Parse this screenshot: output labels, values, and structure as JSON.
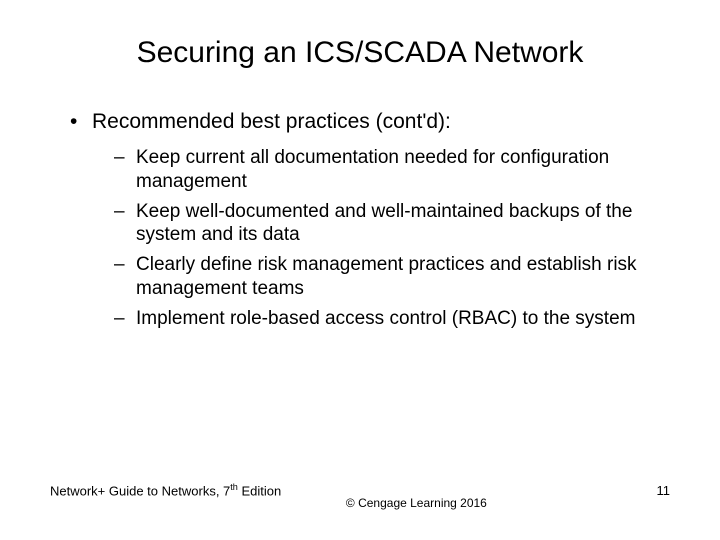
{
  "title": "Securing an ICS/SCADA Network",
  "intro": "Recommended best practices (cont'd):",
  "bullets": [
    "Keep current all documentation needed for configuration management",
    "Keep well-documented and well-maintained backups of the system and its data",
    "Clearly define risk management practices and establish risk management teams",
    "Implement role-based access control (RBAC) to the system"
  ],
  "footer": {
    "left_prefix": "Network+ Guide to Networks, 7",
    "left_suffix": " Edition",
    "ordinal": "th",
    "copyright": "© Cengage Learning  2016",
    "page": "11"
  }
}
